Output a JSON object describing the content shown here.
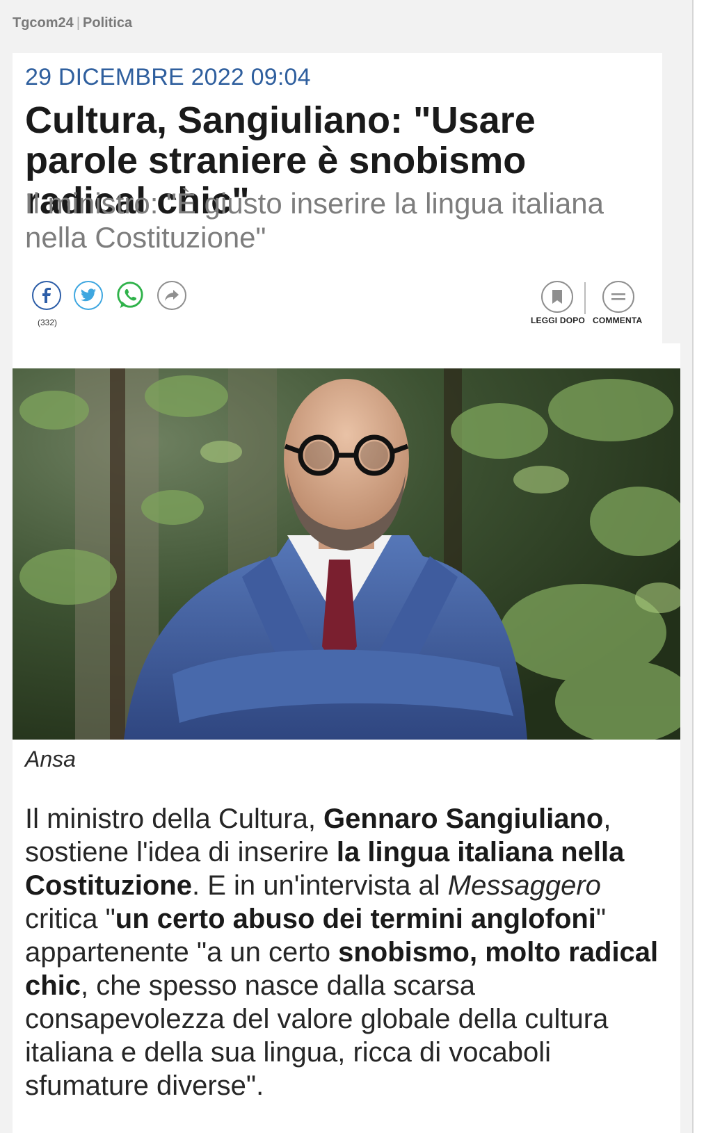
{
  "breadcrumb": {
    "site": "Tgcom24",
    "section": "Politica"
  },
  "article": {
    "date": "29 DICEMBRE 2022 09:04",
    "title": "Cultura, Sangiuliano: \"Usare parole straniere è snobismo radical chic\"",
    "subtitle": "Il ministro: \"È giusto inserire la lingua italiana nella Costituzione\"",
    "photo_credit": "Ansa",
    "body": {
      "s1": "Il ministro della Cultura, ",
      "b1": "Gennaro Sangiuliano",
      "s2": ", sostiene l'idea di inserire ",
      "b2": "la lingua italiana nella Costituzione",
      "s3": ". E in un'intervista al ",
      "i1": "Messaggero",
      "s4": " critica \"",
      "b3": "un certo abuso dei termini anglofoni",
      "s5": "\" appartenente \"a un certo ",
      "b4": "snobismo, molto radical chic",
      "s6": ", che spesso nasce dalla scarsa consapevolezza del valore globale della cultura italiana e della sua lingua, ricca di vocaboli sfumature diverse\"."
    }
  },
  "share": {
    "facebook_count": "(332)",
    "icons": [
      "facebook-icon",
      "twitter-icon",
      "whatsapp-icon",
      "share-arrow-icon"
    ]
  },
  "actions": {
    "read_later": "LEGGI DOPO",
    "comment": "COMMENTA"
  },
  "colors": {
    "date": "#2f5f9e",
    "facebook": "#2d5ea8",
    "twitter": "#3fa7e0",
    "whatsapp": "#2fb24a"
  }
}
